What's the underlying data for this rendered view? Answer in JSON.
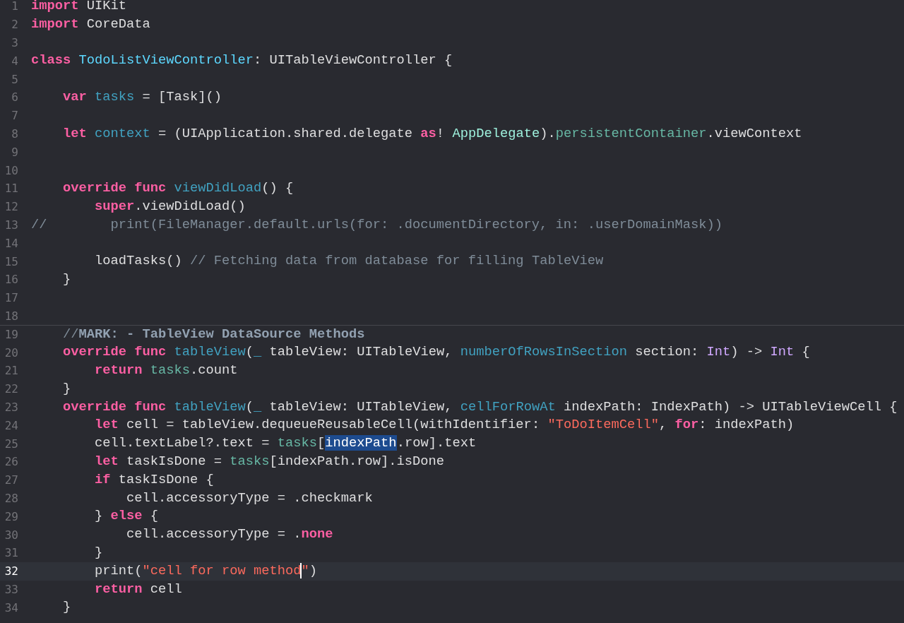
{
  "editor": {
    "lines": [
      {
        "number": "1",
        "current": false,
        "separator": false,
        "tokens": [
          {
            "kind": "keyword",
            "text": "import"
          },
          {
            "kind": "plain",
            "text": " UIKit"
          }
        ]
      },
      {
        "number": "2",
        "current": false,
        "separator": false,
        "tokens": [
          {
            "kind": "keyword",
            "text": "import"
          },
          {
            "kind": "plain",
            "text": " CoreData"
          }
        ]
      },
      {
        "number": "3",
        "current": false,
        "separator": false
      },
      {
        "number": "4",
        "current": false,
        "separator": false,
        "tokens": [
          {
            "kind": "keyword",
            "text": "class"
          },
          {
            "kind": "typedecl",
            "text": " TodoListViewController"
          },
          {
            "kind": "plain",
            "text": ": UITableViewController {"
          }
        ]
      },
      {
        "number": "5",
        "current": false,
        "separator": false
      },
      {
        "number": "6",
        "current": false,
        "separator": false,
        "tokens": [
          {
            "kind": "keyword",
            "text": "    var"
          },
          {
            "kind": "decl",
            "text": " tasks"
          },
          {
            "kind": "plain",
            "text": " = [Task]()"
          }
        ]
      },
      {
        "number": "7",
        "current": false,
        "separator": false
      },
      {
        "number": "8",
        "current": false,
        "separator": false,
        "tokens": [
          {
            "kind": "keyword",
            "text": "    let"
          },
          {
            "kind": "decl",
            "text": " context"
          },
          {
            "kind": "plain",
            "text": " = (UIApplication.shared.delegate "
          },
          {
            "kind": "keyword",
            "text": "as"
          },
          {
            "kind": "plain",
            "text": "! "
          },
          {
            "kind": "projtype",
            "text": "AppDelegate"
          },
          {
            "kind": "plain",
            "text": ")."
          },
          {
            "kind": "projref",
            "text": "persistentContainer"
          },
          {
            "kind": "plain",
            "text": ".viewContext"
          }
        ]
      },
      {
        "number": "9",
        "current": false,
        "separator": false
      },
      {
        "number": "10",
        "current": false,
        "separator": false
      },
      {
        "number": "11",
        "current": false,
        "separator": false,
        "tokens": [
          {
            "kind": "keyword",
            "text": "    override func"
          },
          {
            "kind": "decl",
            "text": " viewDidLoad"
          },
          {
            "kind": "plain",
            "text": "() {"
          }
        ]
      },
      {
        "number": "12",
        "current": false,
        "separator": false,
        "tokens": [
          {
            "kind": "keyword",
            "text": "        super"
          },
          {
            "kind": "plain",
            "text": ".viewDidLoad()"
          }
        ]
      },
      {
        "number": "13",
        "current": false,
        "separator": false,
        "tokens": [
          {
            "kind": "comment",
            "text": "//        print(FileManager.default.urls(for: .documentDirectory, in: .userDomainMask))"
          }
        ]
      },
      {
        "number": "14",
        "current": false,
        "separator": false
      },
      {
        "number": "15",
        "current": false,
        "separator": false,
        "tokens": [
          {
            "kind": "plain",
            "text": "        loadTasks() "
          },
          {
            "kind": "comment",
            "text": "// Fetching data from database for filling TableView"
          }
        ]
      },
      {
        "number": "16",
        "current": false,
        "separator": false,
        "tokens": [
          {
            "kind": "plain",
            "text": "    }"
          }
        ]
      },
      {
        "number": "17",
        "current": false,
        "separator": false
      },
      {
        "number": "18",
        "current": false,
        "separator": false
      },
      {
        "number": "19",
        "current": false,
        "separator": true,
        "tokens": [
          {
            "kind": "comment",
            "text": "    //"
          },
          {
            "kind": "mark",
            "text": "MARK: - TableView DataSource Methods"
          }
        ]
      },
      {
        "number": "20",
        "current": false,
        "separator": false,
        "tokens": [
          {
            "kind": "keyword",
            "text": "    override func"
          },
          {
            "kind": "decl",
            "text": " tableView"
          },
          {
            "kind": "plain",
            "text": "("
          },
          {
            "kind": "decl",
            "text": "_"
          },
          {
            "kind": "plain",
            "text": " tableView: UITableView, "
          },
          {
            "kind": "decl",
            "text": "numberOfRowsInSection"
          },
          {
            "kind": "plain",
            "text": " section: "
          },
          {
            "kind": "systype",
            "text": "Int"
          },
          {
            "kind": "plain",
            "text": ") -> "
          },
          {
            "kind": "systype",
            "text": "Int"
          },
          {
            "kind": "plain",
            "text": " {"
          }
        ]
      },
      {
        "number": "21",
        "current": false,
        "separator": false,
        "tokens": [
          {
            "kind": "keyword",
            "text": "        return"
          },
          {
            "kind": "projref",
            "text": " tasks"
          },
          {
            "kind": "plain",
            "text": ".count"
          }
        ]
      },
      {
        "number": "22",
        "current": false,
        "separator": false,
        "tokens": [
          {
            "kind": "plain",
            "text": "    }"
          }
        ]
      },
      {
        "number": "23",
        "current": false,
        "separator": false,
        "tokens": [
          {
            "kind": "keyword",
            "text": "    override func"
          },
          {
            "kind": "decl",
            "text": " tableView"
          },
          {
            "kind": "plain",
            "text": "("
          },
          {
            "kind": "decl",
            "text": "_"
          },
          {
            "kind": "plain",
            "text": " tableView: UITableView, "
          },
          {
            "kind": "decl",
            "text": "cellForRowAt"
          },
          {
            "kind": "plain",
            "text": " indexPath: IndexPath) -> UITableViewCell {"
          }
        ]
      },
      {
        "number": "24",
        "current": false,
        "separator": false,
        "tokens": [
          {
            "kind": "keyword",
            "text": "        let"
          },
          {
            "kind": "plain",
            "text": " cell = tableView.dequeueReusableCell(withIdentifier: "
          },
          {
            "kind": "string",
            "text": "\"ToDoItemCell\""
          },
          {
            "kind": "plain",
            "text": ", "
          },
          {
            "kind": "keyword",
            "text": "for"
          },
          {
            "kind": "plain",
            "text": ": indexPath)"
          }
        ]
      },
      {
        "number": "25",
        "current": false,
        "separator": false,
        "tokens": [
          {
            "kind": "plain",
            "text": "        cell.textLabel?.text = "
          },
          {
            "kind": "projref",
            "text": "tasks"
          },
          {
            "kind": "plain",
            "text": "["
          },
          {
            "kind": "selection",
            "text": "indexPath"
          },
          {
            "kind": "plain",
            "text": ".row].text"
          }
        ]
      },
      {
        "number": "26",
        "current": false,
        "separator": false,
        "tokens": [
          {
            "kind": "keyword",
            "text": "        let"
          },
          {
            "kind": "plain",
            "text": " taskIsDone = "
          },
          {
            "kind": "projref",
            "text": "tasks"
          },
          {
            "kind": "plain",
            "text": "[indexPath.row].isDone"
          }
        ]
      },
      {
        "number": "27",
        "current": false,
        "separator": false,
        "tokens": [
          {
            "kind": "keyword",
            "text": "        if"
          },
          {
            "kind": "plain",
            "text": " taskIsDone {"
          }
        ]
      },
      {
        "number": "28",
        "current": false,
        "separator": false,
        "tokens": [
          {
            "kind": "plain",
            "text": "            cell.accessoryType = .checkmark"
          }
        ]
      },
      {
        "number": "29",
        "current": false,
        "separator": false,
        "tokens": [
          {
            "kind": "plain",
            "text": "        } "
          },
          {
            "kind": "keyword",
            "text": "else"
          },
          {
            "kind": "plain",
            "text": " {"
          }
        ]
      },
      {
        "number": "30",
        "current": false,
        "separator": false,
        "tokens": [
          {
            "kind": "plain",
            "text": "            cell.accessoryType = ."
          },
          {
            "kind": "keyword",
            "text": "none"
          }
        ]
      },
      {
        "number": "31",
        "current": false,
        "separator": false,
        "tokens": [
          {
            "kind": "plain",
            "text": "        }"
          }
        ]
      },
      {
        "number": "32",
        "current": true,
        "separator": false,
        "tokens": [
          {
            "kind": "plain",
            "text": "        print("
          },
          {
            "kind": "string",
            "text": "\"cell for row method",
            "caret": true
          },
          {
            "kind": "string",
            "text": "\""
          },
          {
            "kind": "plain",
            "text": ")"
          }
        ]
      },
      {
        "number": "33",
        "current": false,
        "separator": false,
        "tokens": [
          {
            "kind": "keyword",
            "text": "        return"
          },
          {
            "kind": "plain",
            "text": " cell"
          }
        ]
      },
      {
        "number": "34",
        "current": false,
        "separator": false,
        "tokens": [
          {
            "kind": "plain",
            "text": "    }"
          }
        ]
      }
    ]
  }
}
